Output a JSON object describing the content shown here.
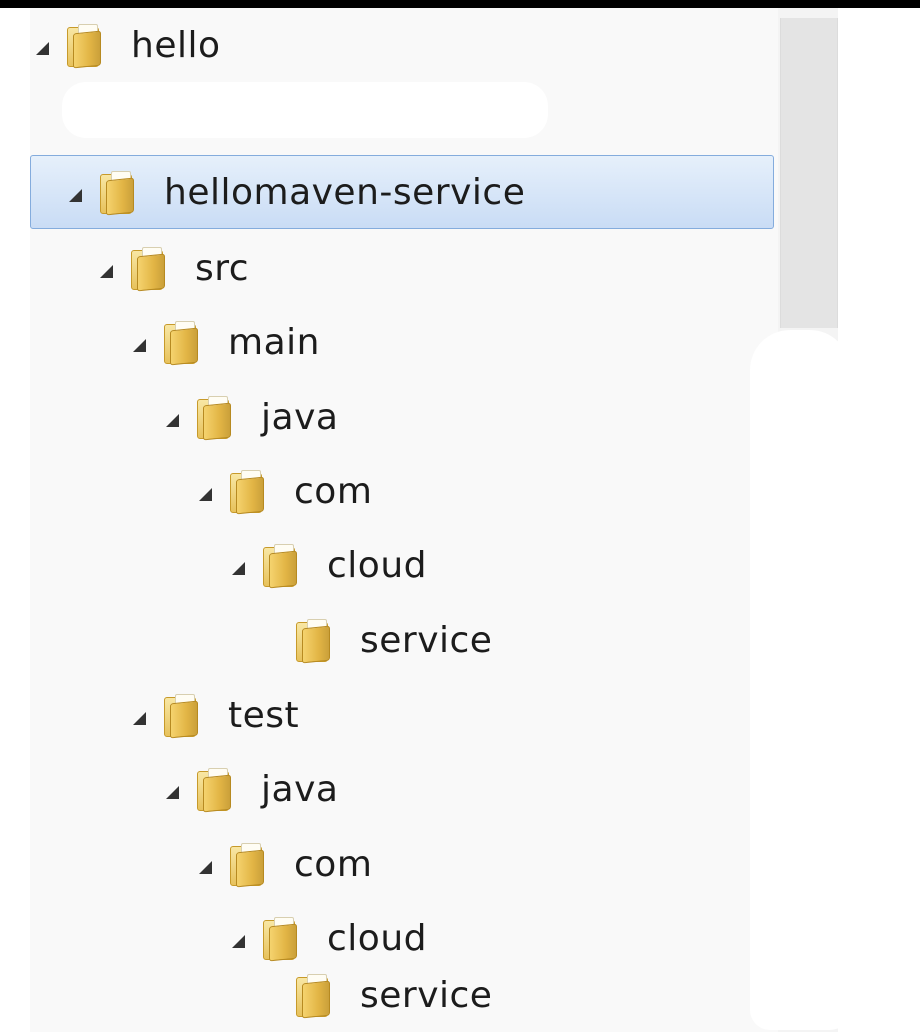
{
  "tree": {
    "items": [
      {
        "label": "hello",
        "depth": 0,
        "expanded": true,
        "selected": false
      },
      {
        "label": "hellomaven-service",
        "depth": 1,
        "expanded": true,
        "selected": true
      },
      {
        "label": "src",
        "depth": 2,
        "expanded": true,
        "selected": false
      },
      {
        "label": "main",
        "depth": 3,
        "expanded": true,
        "selected": false
      },
      {
        "label": "java",
        "depth": 4,
        "expanded": true,
        "selected": false
      },
      {
        "label": "com",
        "depth": 5,
        "expanded": true,
        "selected": false
      },
      {
        "label": "cloud",
        "depth": 6,
        "expanded": true,
        "selected": false
      },
      {
        "label": "service",
        "depth": 7,
        "expanded": null,
        "selected": false
      },
      {
        "label": "test",
        "depth": 3,
        "expanded": true,
        "selected": false
      },
      {
        "label": "java",
        "depth": 4,
        "expanded": true,
        "selected": false
      },
      {
        "label": "com",
        "depth": 5,
        "expanded": true,
        "selected": false
      },
      {
        "label": "cloud",
        "depth": 6,
        "expanded": true,
        "selected": false
      },
      {
        "label": "service",
        "depth": 7,
        "expanded": null,
        "selected": false
      }
    ]
  },
  "colors": {
    "selection_border": "#84acdd",
    "selection_fill": "#c9dcf5",
    "folder": "#e2b545"
  },
  "icons": {
    "expanded": "expanded-triangle-icon",
    "folder": "folder-icon"
  }
}
